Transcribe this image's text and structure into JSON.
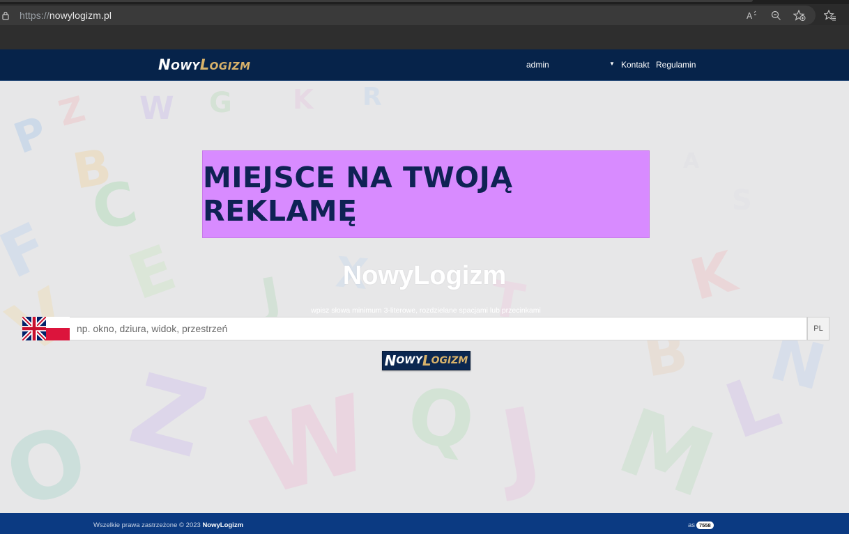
{
  "browser": {
    "url_scheme": "https://",
    "url_host": "nowylogizm.pl",
    "icons": [
      "lock-icon",
      "read-aloud-icon",
      "zoom-out-icon",
      "add-favorite-icon",
      "favorites-icon"
    ]
  },
  "navbar": {
    "brand_part1": "N",
    "brand_part1_small": "OWY",
    "brand_part2": "L",
    "brand_part2_small": "OGIZM",
    "user": "admin",
    "links": [
      "Kontakt",
      "Regulamin"
    ]
  },
  "ad": {
    "text": "MIEJSCE NA TWOJĄ REKLAMĘ"
  },
  "hero": {
    "title": "NowyLogizm",
    "hint": "wpisz słowa minimum 3-literowe, rozdzielane spacjami lub przecinkami"
  },
  "search": {
    "placeholder": "np. okno, dziura, widok, przestrzeń",
    "value": "",
    "lang": "PL"
  },
  "submit": {
    "part1": "N",
    "part1_small": "OWY",
    "part2": "L",
    "part2_small": "OGIZM"
  },
  "footer": {
    "copyright": "Wszelkie prawa zastrzeżone © 2023 ",
    "brand": "NowyLogizm",
    "as_label": "as",
    "counter": "7558"
  },
  "colors": {
    "navbar": "#06234a",
    "footer": "#0b3a82",
    "ad_background": "#d88bff",
    "ad_text": "#0f2254",
    "brand_accent": "#d8b26a"
  }
}
